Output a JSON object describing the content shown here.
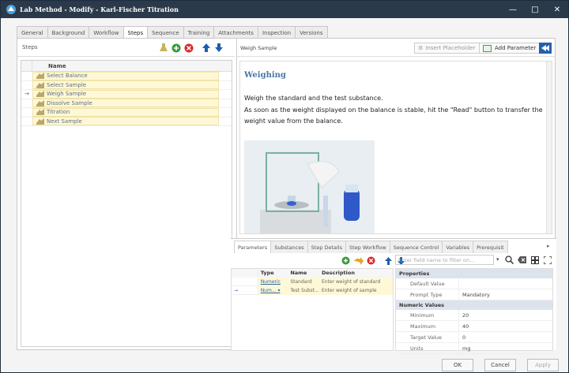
{
  "window": {
    "title": "Lab Method - Modify - Karl-Fischer Titration"
  },
  "tabs": [
    "General",
    "Background",
    "Workflow",
    "Steps",
    "Sequence",
    "Training",
    "Attachments",
    "Inspection",
    "Versions"
  ],
  "active_tab": "Steps",
  "left": {
    "label": "Steps",
    "column": "Name",
    "rows": [
      "Select Balance",
      "Select Sample",
      "Weigh Sample",
      "Dissolve Sample",
      "Titration",
      "Next Sample"
    ],
    "current_row": 2
  },
  "right": {
    "label": "Weigh Sample",
    "insert_placeholder": "Insert Placeholder",
    "add_parameter": "Add Parameter"
  },
  "content": {
    "heading": "Weighing",
    "line1": "Weigh the standard and the test substance.",
    "line2": "As soon as the weight displayed on the balance is stable, hit the \"Read\" button to transfer the weight value from the balance."
  },
  "bottom_tabs": [
    "Parameters",
    "Substances",
    "Step Details",
    "Step Workflow",
    "Sequence Control",
    "Variables",
    "Prerequisit"
  ],
  "params": {
    "headers": [
      "Type",
      "Name",
      "Description"
    ],
    "rows": [
      [
        "Numeric",
        "Standard",
        "Enter weight of standard"
      ],
      [
        "Num... ▾",
        "Test Subst...",
        "Enter weight of sample"
      ]
    ]
  },
  "filter_placeholder": "Enter field name to filter on...",
  "props": {
    "sections": [
      {
        "title": "Properties",
        "items": [
          [
            "Default Value",
            ""
          ],
          [
            "Prompt Type",
            "Mandatory"
          ]
        ]
      },
      {
        "title": "Numeric Values",
        "items": [
          [
            "Minimum",
            "20"
          ],
          [
            "Maximum",
            "40"
          ],
          [
            "Target Value",
            "0"
          ],
          [
            "Units",
            "mg"
          ]
        ]
      }
    ]
  },
  "footer": {
    "ok": "OK",
    "cancel": "Cancel",
    "apply": "Apply"
  }
}
